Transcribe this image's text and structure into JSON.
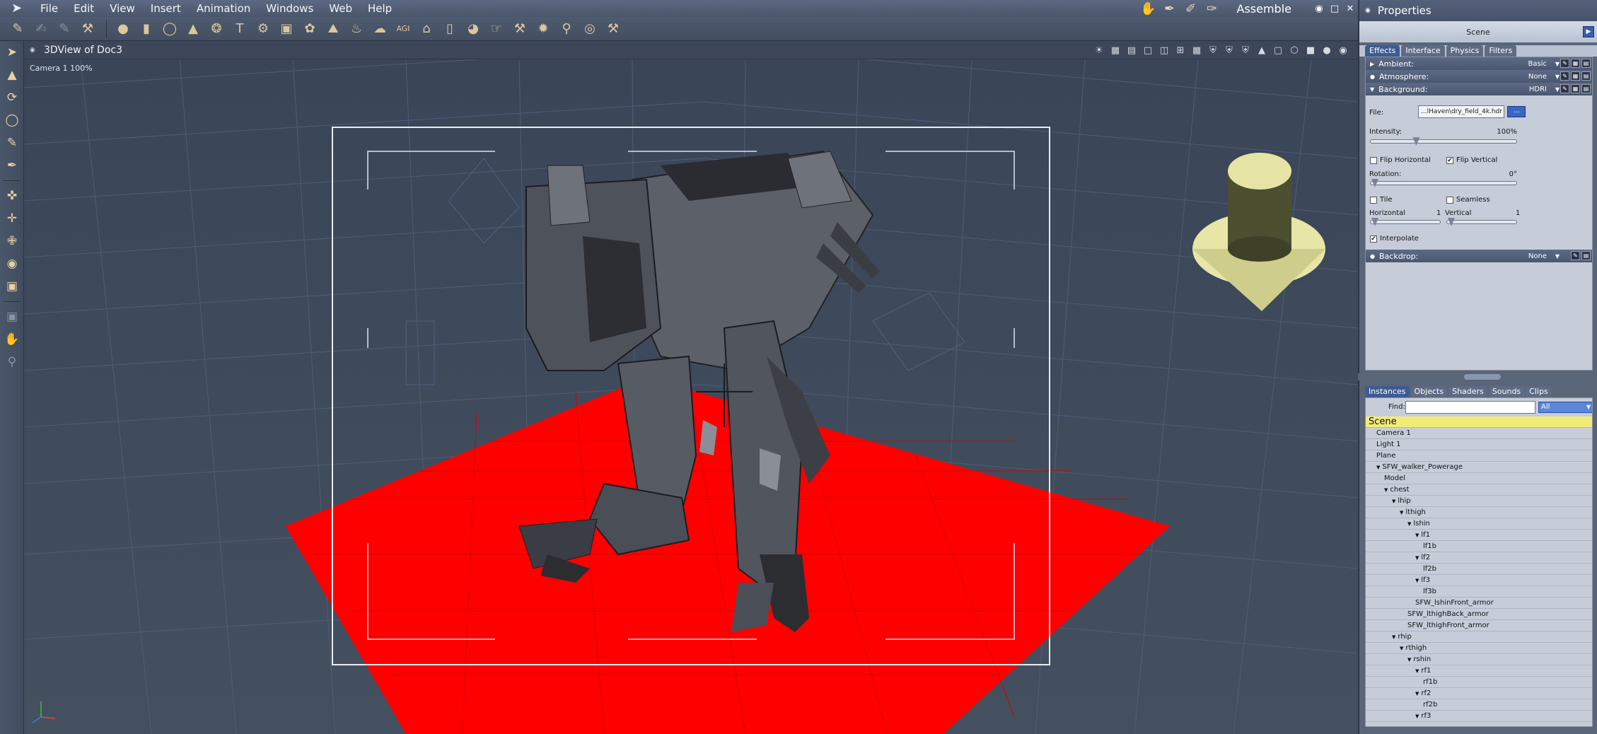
{
  "menubar": {
    "items": [
      "File",
      "Edit",
      "View",
      "Insert",
      "Animation",
      "Windows",
      "Web",
      "Help"
    ],
    "mode": "Assemble",
    "window_controls": [
      "◉",
      "□",
      "✕"
    ]
  },
  "toolbar": {
    "icons": [
      "pencil-tool",
      "lock-tool",
      "unlock-tool",
      "pan-tool",
      "sphere-primitive",
      "cylinder-primitive",
      "torus-primitive",
      "cone-primitive",
      "spiral-primitive",
      "text-primitive",
      "gear-primitive",
      "plane-primitive",
      "mesh-primitive",
      "terrain-primitive",
      "water-primitive",
      "cloud-primitive",
      "agi-primitive",
      "house-primitive",
      "tube-primitive",
      "pot-primitive",
      "hand-primitive",
      "tool-primitive",
      "bug-primitive",
      "link-primitive",
      "circle-primitive",
      "wrench-primitive"
    ]
  },
  "view": {
    "title": "3DView of Doc3",
    "camera_label": "Camera 1 100%"
  },
  "properties": {
    "title": "Properties",
    "scene_label": "Scene",
    "tabs": [
      "Effects",
      "Interface",
      "Physics",
      "Filters"
    ],
    "active_tab": "Effects",
    "sections": {
      "ambient": {
        "label": "Ambient:",
        "value": "Basic"
      },
      "atmosphere": {
        "label": "Atmosphere:",
        "value": "None"
      },
      "background": {
        "label": "Background:",
        "value": "HDRI"
      },
      "backdrop": {
        "label": "Backdrop:",
        "value": "None"
      }
    },
    "background_fields": {
      "file_label": "File:",
      "file_value": "...lHaven\\dry_field_4k.hdr",
      "file_button": "...",
      "intensity_label": "Intensity:",
      "intensity_value": "100%",
      "intensity_fraction": 0.3,
      "flip_horizontal": "Flip Horizontal",
      "flip_horizontal_checked": false,
      "flip_vertical": "Flip Vertical",
      "flip_vertical_checked": true,
      "rotation_label": "Rotation:",
      "rotation_value": "0°",
      "tile": "Tile",
      "tile_checked": false,
      "seamless": "Seamless",
      "seamless_checked": false,
      "horizontal_label": "Horizontal",
      "horizontal_value": "1",
      "vertical_label": "Vertical",
      "vertical_value": "1",
      "interpolate": "Interpolate",
      "interpolate_checked": true
    }
  },
  "instances": {
    "tabs": [
      "Instances",
      "Objects",
      "Shaders",
      "Sounds",
      "Clips"
    ],
    "active_tab": "Instances",
    "find_label": "Find:",
    "find_value": "",
    "filter_value": "All",
    "rows": [
      {
        "label": "Scene",
        "depth": 0,
        "selected": true
      },
      {
        "label": "Camera 1",
        "depth": 1
      },
      {
        "label": "Light 1",
        "depth": 1
      },
      {
        "label": "Plane",
        "depth": 1
      },
      {
        "label": "SFW_walker_Powerage",
        "depth": 1,
        "expander": "▼"
      },
      {
        "label": "Model",
        "depth": 2
      },
      {
        "label": "chest",
        "depth": 2,
        "expander": "▼"
      },
      {
        "label": "lhip",
        "depth": 3,
        "expander": "▼"
      },
      {
        "label": "lthigh",
        "depth": 4,
        "expander": "▼"
      },
      {
        "label": "lshin",
        "depth": 5,
        "expander": "▼"
      },
      {
        "label": "lf1",
        "depth": 6,
        "expander": "▼"
      },
      {
        "label": "lf1b",
        "depth": 7
      },
      {
        "label": "lf2",
        "depth": 6,
        "expander": "▼"
      },
      {
        "label": "lf2b",
        "depth": 7
      },
      {
        "label": "lf3",
        "depth": 6,
        "expander": "▼"
      },
      {
        "label": "lf3b",
        "depth": 7
      },
      {
        "label": "SFW_lshinFront_armor",
        "depth": 6
      },
      {
        "label": "SFW_lthighBack_armor",
        "depth": 5
      },
      {
        "label": "SFW_lthighFront_armor",
        "depth": 5
      },
      {
        "label": "rhip",
        "depth": 3,
        "expander": "▼"
      },
      {
        "label": "rthigh",
        "depth": 4,
        "expander": "▼"
      },
      {
        "label": "rshin",
        "depth": 5,
        "expander": "▼"
      },
      {
        "label": "rf1",
        "depth": 6,
        "expander": "▼"
      },
      {
        "label": "rf1b",
        "depth": 7
      },
      {
        "label": "rf2",
        "depth": 6,
        "expander": "▼"
      },
      {
        "label": "rf2b",
        "depth": 7
      },
      {
        "label": "rf3",
        "depth": 6,
        "expander": "▼"
      }
    ]
  },
  "colors": {
    "floor_plane": "#ff0000",
    "cone_object": "#e8e6a6",
    "selection_highlight": "#f1ec78",
    "viewport_bg": "#3b4658"
  }
}
